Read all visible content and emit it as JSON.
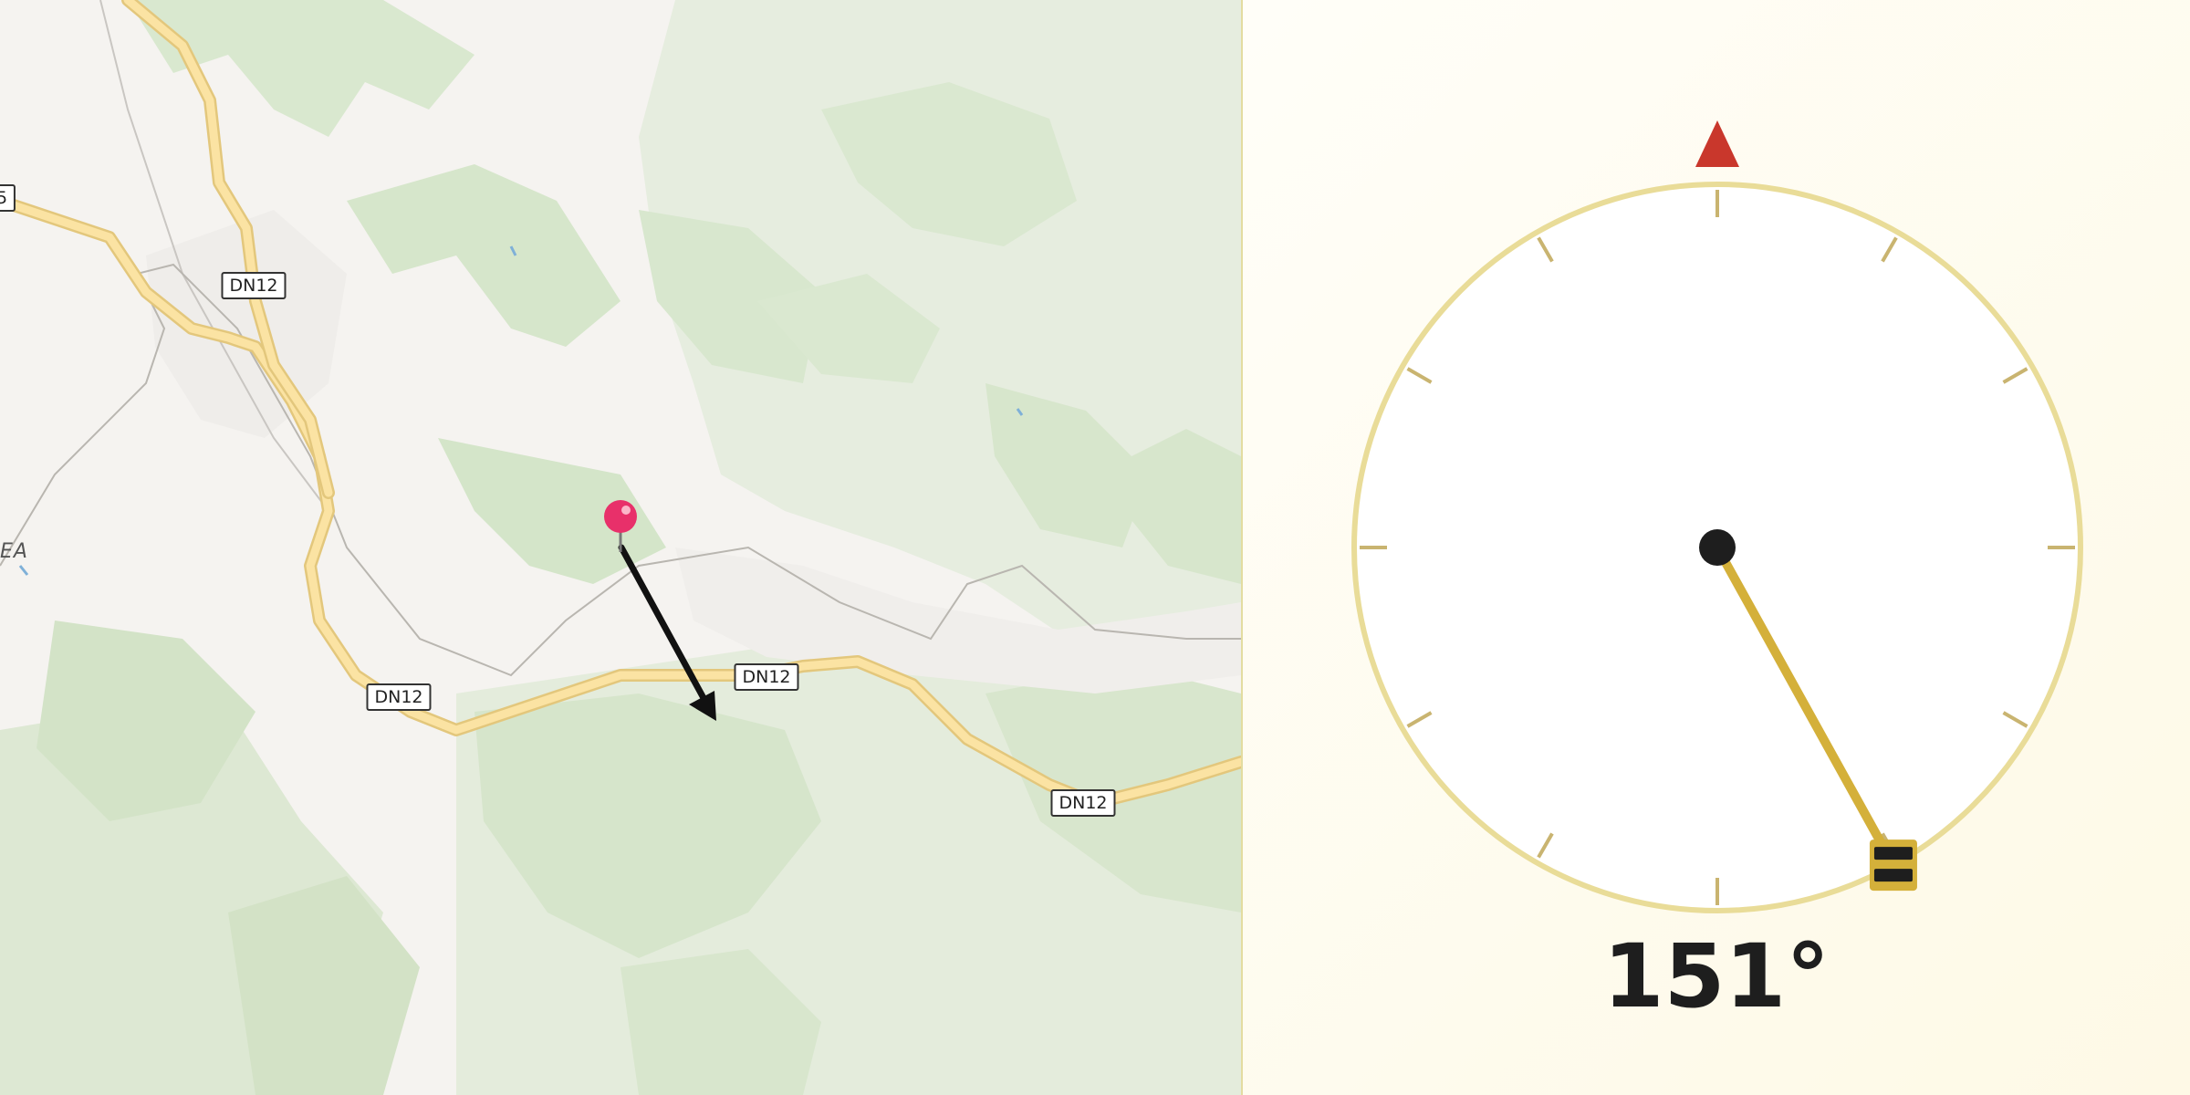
{
  "map": {
    "road_labels": [
      "DN12",
      "DN12",
      "DN12",
      "DN12",
      "5"
    ],
    "place_labels": [
      "EA"
    ],
    "pin": {
      "name": "map-pin-icon",
      "color": "#e8306a"
    },
    "direction_arrow": {
      "name": "heading-arrow-icon",
      "color": "#111111"
    }
  },
  "compass": {
    "heading_degrees": 151,
    "heading_text": "151°",
    "north_marker": {
      "name": "north-triangle-icon",
      "color": "#c9372c"
    },
    "dial_color": "#e9dc98",
    "needle_color": "#d4b03a",
    "handle": {
      "name": "rotate-handle-icon"
    }
  }
}
